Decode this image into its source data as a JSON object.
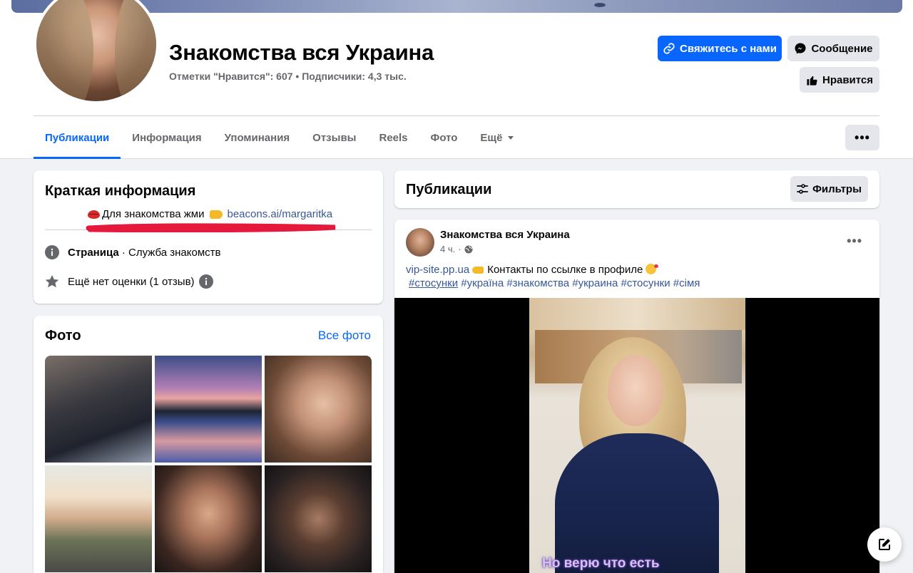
{
  "page": {
    "name": "Знакомства вся Украина",
    "stats": "Отметки \"Нравится\": 607 • Подписчики: 4,3 тыс."
  },
  "actions": {
    "contact_label": "Свяжитесь с нами",
    "message_label": "Сообщение",
    "like_label": "Нравится",
    "more_label": "•••"
  },
  "tabs": [
    {
      "label": "Публикации",
      "active": true
    },
    {
      "label": "Информация"
    },
    {
      "label": "Упоминания"
    },
    {
      "label": "Отзывы"
    },
    {
      "label": "Reels"
    },
    {
      "label": "Фото"
    },
    {
      "label": "Ещё"
    }
  ],
  "intro": {
    "title": "Краткая информация",
    "bio_text": "Для знакомства жми",
    "bio_link": "beacons.ai/margaritka",
    "page_type_label": "Страница",
    "page_type_value": " · Служба знакомств",
    "rating_text": "Ещё нет оценки (1 отзыв)"
  },
  "photos": {
    "title": "Фото",
    "all_label": "Все фото"
  },
  "posts": {
    "title": "Публикации",
    "filters_label": "Фильтры"
  },
  "post": {
    "author": "Знакомства вся Украина",
    "time": "4 ч.",
    "link": "vip-site.pp.ua",
    "text": "Контакты по ссылке в профиле",
    "first_tag": "#стосунки",
    "tags": " #україна #знакомства #украина #стосунки #сімя",
    "more_label": "•••",
    "video_subtitle": "Но верю что есть"
  },
  "colors": {
    "accent": "#0866ff",
    "link": "#385898",
    "background": "#f0f2f5",
    "scribble": "#e5193b"
  }
}
